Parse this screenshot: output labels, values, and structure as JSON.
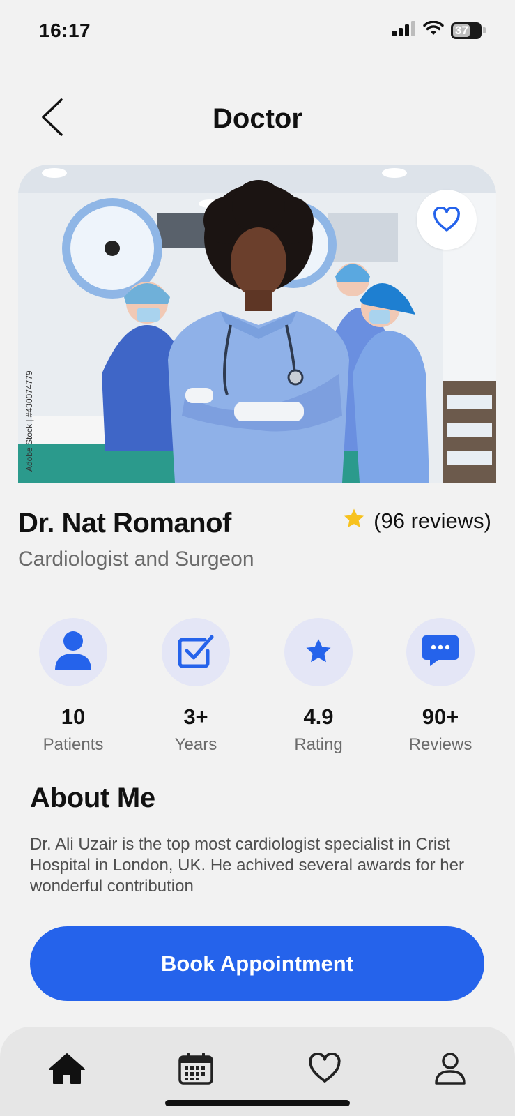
{
  "status_bar": {
    "time": "16:17",
    "battery": "37"
  },
  "header": {
    "title": "Doctor",
    "back_icon": "chevron-left-icon"
  },
  "hero": {
    "favorite_icon": "heart-outline-icon",
    "watermark": "Adobe Stock | #430074779"
  },
  "doctor": {
    "name": "Dr. Nat Romanof",
    "specialty": "Cardiologist and Surgeon",
    "reviews_text": "(96 reviews)",
    "star_color": "#f7c21e"
  },
  "stats": [
    {
      "icon": "user-icon",
      "value": "10",
      "label": "Patients"
    },
    {
      "icon": "checkbox-icon",
      "value": "3+",
      "label": "Years"
    },
    {
      "icon": "star-icon",
      "value": "4.9",
      "label": "Rating"
    },
    {
      "icon": "chat-bubble-icon",
      "value": "90+",
      "label": "Reviews"
    }
  ],
  "about": {
    "title": "About Me",
    "text": "Dr. Ali Uzair is the top most cardiologist specialist in Crist Hospital in London, UK. He achived several awards for her wonderful contribution"
  },
  "cta": {
    "label": "Book Appointment"
  },
  "bottom_nav": [
    {
      "icon": "home-icon",
      "active": true
    },
    {
      "icon": "calendar-icon",
      "active": false
    },
    {
      "icon": "heart-icon",
      "active": false
    },
    {
      "icon": "profile-icon",
      "active": false
    }
  ],
  "colors": {
    "accent": "#2563eb",
    "background": "#f2f2f2",
    "stat_circle": "#e4e6f6",
    "nav_background": "#e6e6e6"
  }
}
